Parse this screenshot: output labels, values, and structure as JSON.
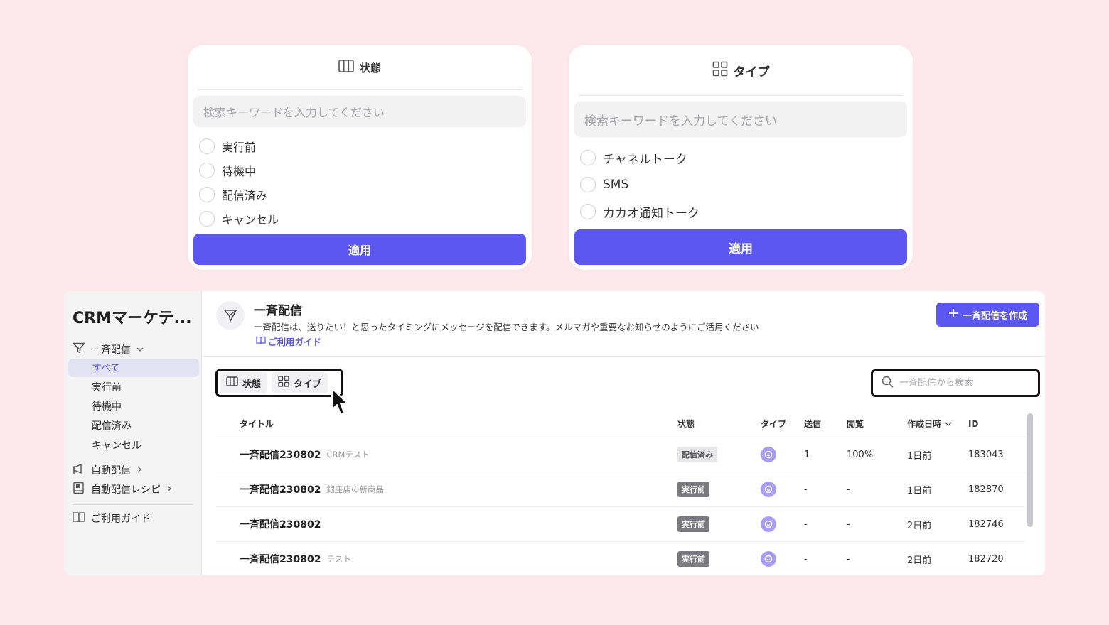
{
  "popover_status": {
    "title": "状態",
    "title_icon": "columns-icon",
    "search_placeholder": "検索キーワードを入力してください",
    "options": [
      "実行前",
      "待機中",
      "配信済み",
      "キャンセル"
    ],
    "apply_label": "適用"
  },
  "popover_type": {
    "title": "タイプ",
    "title_icon": "grid-icon",
    "search_placeholder": "検索キーワードを入力してください",
    "options": [
      "チャネルトーク",
      "SMS",
      "カカオ通知トーク"
    ],
    "apply_label": "適用"
  },
  "sidebar": {
    "brand": "CRMマーケテ...",
    "broadcast": {
      "label": "一斉配信",
      "icon": "filter-funnel-icon"
    },
    "broadcast_sub": [
      "すべて",
      "実行前",
      "待機中",
      "配信済み",
      "キャンセル"
    ],
    "auto": {
      "label": "自動配信",
      "icon": "megaphone-icon"
    },
    "recipe": {
      "label": "自動配信レシピ",
      "icon": "recipe-book-icon"
    },
    "guide": {
      "label": "ご利用ガイド",
      "icon": "book-icon"
    }
  },
  "header": {
    "title": "一斉配信",
    "description": "一斉配信は、送りたい！と思ったタイミングにメッセージを配信できます。メルマガや重要なお知らせのようにご活用ください",
    "guide_link": "ご利用ガイド",
    "create_button": "一斉配信を作成"
  },
  "toolbar": {
    "status_filter": "状態",
    "type_filter": "タイプ",
    "search_placeholder": "一斉配信から検索"
  },
  "table": {
    "columns": {
      "title": "タイトル",
      "status": "状態",
      "type": "タイプ",
      "sent": "送信",
      "view": "閲覧",
      "date": "作成日時",
      "id": "ID"
    },
    "rows": [
      {
        "title": "一斉配信230802",
        "sub": "CRMテスト",
        "status": "配信済み",
        "sent": "1",
        "view": "100%",
        "date": "1日前",
        "id": "183043"
      },
      {
        "title": "一斉配信230802",
        "sub": "銀座店の新商品",
        "status": "実行前",
        "sent": "-",
        "view": "-",
        "date": "1日前",
        "id": "182870"
      },
      {
        "title": "一斉配信230802",
        "sub": "",
        "status": "実行前",
        "sent": "-",
        "view": "-",
        "date": "2日前",
        "id": "182746"
      },
      {
        "title": "一斉配信230802",
        "sub": "テスト",
        "status": "実行前",
        "sent": "-",
        "view": "-",
        "date": "2日前",
        "id": "182720"
      }
    ]
  },
  "colors": {
    "accent": "#5b57f0",
    "background": "#fde8ec",
    "type_icon": "#a89cf5"
  }
}
